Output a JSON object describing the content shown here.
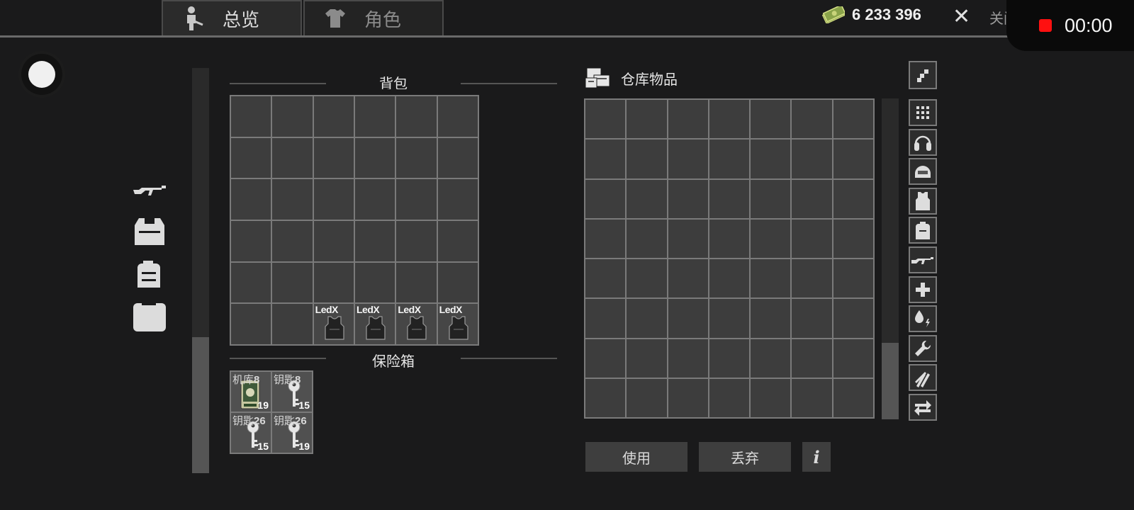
{
  "tabs": {
    "overview": "总览",
    "character": "角色"
  },
  "header": {
    "money": "6 233 396",
    "close_label": "关闭"
  },
  "recording": {
    "time": "00:00"
  },
  "backpack": {
    "title": "背包",
    "rows": 6,
    "cols": 6,
    "items": [
      {
        "label": "LedX"
      },
      {
        "label": "LedX"
      },
      {
        "label": "LedX"
      },
      {
        "label": "LedX"
      }
    ]
  },
  "safe": {
    "title": "保险箱",
    "items": [
      {
        "name": "机库",
        "num": "8",
        "count": "19",
        "icon": "ammo-box-icon"
      },
      {
        "name": "钥匙",
        "num": "8",
        "count": "15",
        "icon": "key-icon"
      },
      {
        "name": "钥匙",
        "num": "26",
        "count": "15",
        "icon": "key-icon"
      },
      {
        "name": "钥匙",
        "num": "26",
        "count": "19",
        "icon": "key-icon"
      }
    ]
  },
  "stash": {
    "title": "仓库物品",
    "rows": 8,
    "cols": 7
  },
  "categories": [
    "all-grid-icon",
    "headset-icon",
    "helmet-icon",
    "vest-icon",
    "backpack-icon",
    "rifle-icon",
    "medical-plus-icon",
    "drink-energy-icon",
    "wrench-icon",
    "ammo-icon",
    "swap-icon"
  ],
  "actions": {
    "use": "使用",
    "discard": "丢弃",
    "info": "i"
  },
  "colors": {
    "background": "#1a1a1b",
    "cell": "#3d3d3d",
    "grid_line": "#7a7a7a",
    "record_dot": "#ff1010"
  }
}
